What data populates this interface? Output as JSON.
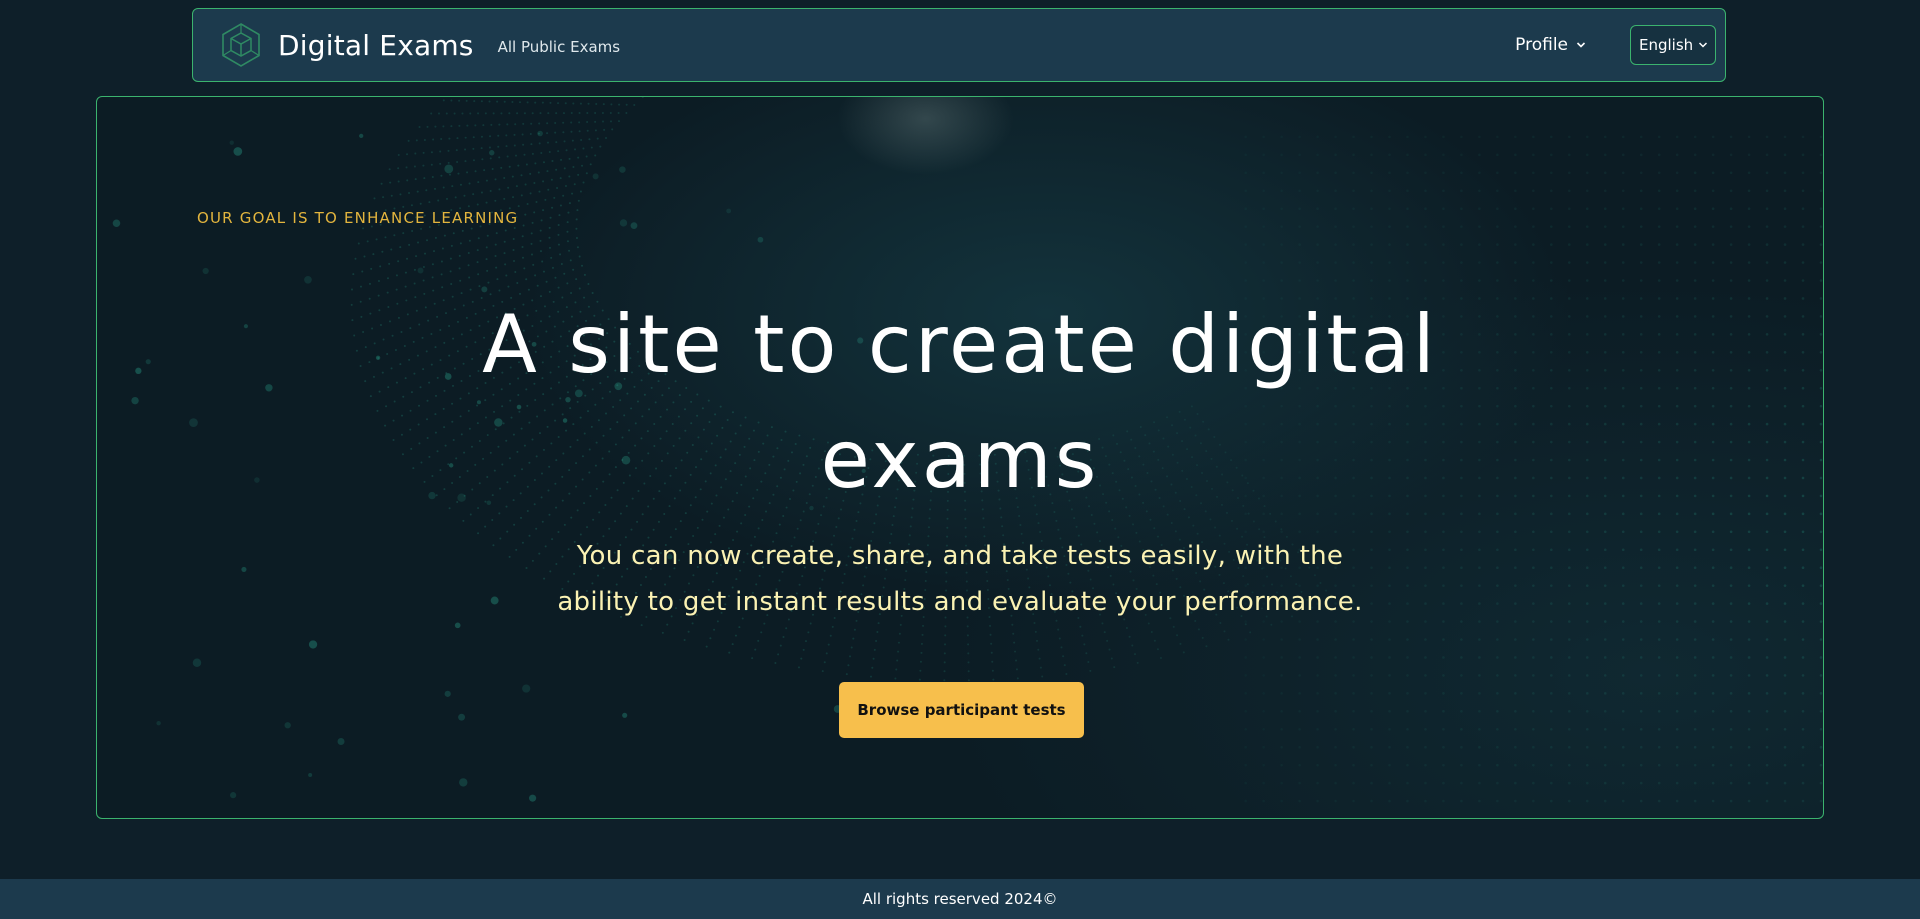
{
  "navbar": {
    "brand_name": "Digital Exams",
    "logo_icon": "cube-hexagon-icon",
    "links": [
      {
        "label": "All Public Exams"
      }
    ],
    "profile_label": "Profile",
    "language_selected": "English"
  },
  "hero": {
    "eyebrow": "OUR GOAL IS TO ENHANCE LEARNING",
    "title_lines": [
      "A site to create digital",
      "exams"
    ],
    "subtitle_lines": [
      "You can now create, share, and take tests easily, with the",
      "ability to get instant results and evaluate your performance."
    ],
    "cta_label": "Browse participant tests"
  },
  "footer": {
    "text": "All rights reserved 2024©"
  },
  "colors": {
    "page_bg": "#0e1f29",
    "nav_bg": "#1c3a4d",
    "border_accent": "#3bb36e",
    "eyebrow": "#e3b53e",
    "subtitle": "#fbf2b3",
    "cta_bg": "#f7bf4c"
  }
}
